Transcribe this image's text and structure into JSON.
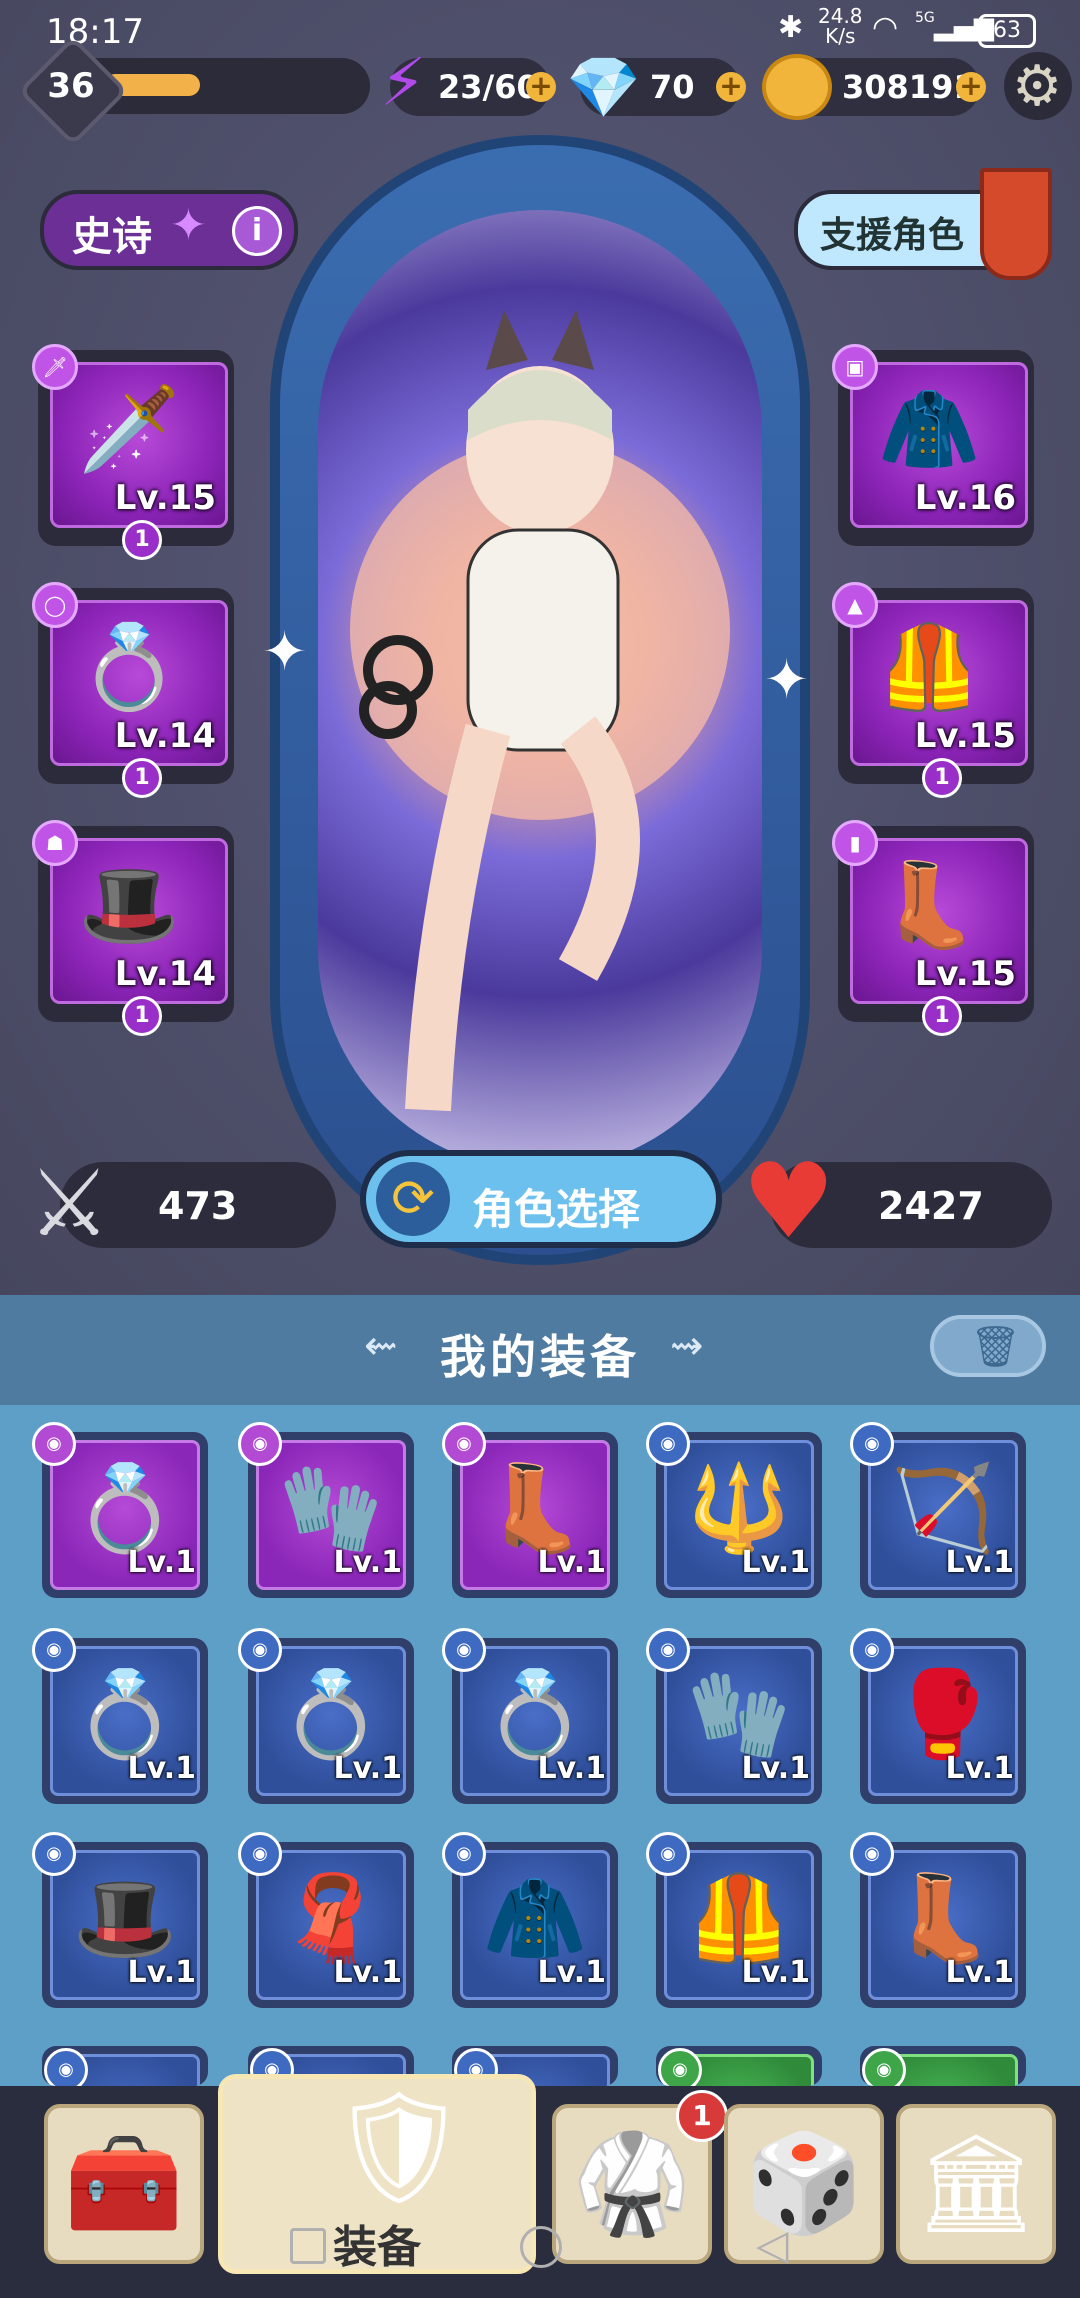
{
  "status_bar": {
    "time": "18:17",
    "net_speed_value": "24.8",
    "net_speed_unit": "K/s",
    "network": "5G",
    "battery": "63"
  },
  "player": {
    "level": "36",
    "xp_fraction": 0.3
  },
  "resources": {
    "energy": "23/60",
    "gems": "70",
    "coins": "308191"
  },
  "rarity_button": {
    "label": "史诗"
  },
  "support_button": {
    "label": "支援角色"
  },
  "left_slots": [
    {
      "name": "weapon-sword",
      "level": "Lv.15",
      "count": "1"
    },
    {
      "name": "ring",
      "level": "Lv.14",
      "count": "1"
    },
    {
      "name": "hat",
      "level": "Lv.14",
      "count": "1"
    }
  ],
  "right_slots": [
    {
      "name": "hood",
      "level": "Lv.16"
    },
    {
      "name": "armor",
      "level": "Lv.15",
      "count": "1"
    },
    {
      "name": "boots",
      "level": "Lv.15",
      "count": "1"
    }
  ],
  "stats": {
    "attack": "473",
    "hp": "2427"
  },
  "character_select": {
    "label": "角色选择"
  },
  "inventory": {
    "title": "我的装备",
    "items": [
      {
        "rarity": "purple",
        "icon": "ring-icon",
        "glyph": "💍",
        "level": "Lv.1"
      },
      {
        "rarity": "purple",
        "icon": "gauntlet-icon",
        "glyph": "🧤",
        "level": "Lv.1"
      },
      {
        "rarity": "purple",
        "icon": "boots-icon",
        "glyph": "👢",
        "level": "Lv.1"
      },
      {
        "rarity": "blue",
        "icon": "staff-icon",
        "glyph": "🔱",
        "level": "Lv.1"
      },
      {
        "rarity": "blue",
        "icon": "bow-icon",
        "glyph": "🏹",
        "level": "Lv.1"
      },
      {
        "rarity": "blue",
        "icon": "ring-icon",
        "glyph": "💍",
        "level": "Lv.1"
      },
      {
        "rarity": "blue",
        "icon": "ring-icon",
        "glyph": "💍",
        "level": "Lv.1"
      },
      {
        "rarity": "blue",
        "icon": "ring-icon",
        "glyph": "💍",
        "level": "Lv.1"
      },
      {
        "rarity": "blue",
        "icon": "gauntlet-icon",
        "glyph": "🧤",
        "level": "Lv.1"
      },
      {
        "rarity": "blue",
        "icon": "gauntlet-icon",
        "glyph": "🥊",
        "level": "Lv.1"
      },
      {
        "rarity": "blue",
        "icon": "hat-icon",
        "glyph": "🎩",
        "level": "Lv.1"
      },
      {
        "rarity": "blue",
        "icon": "scarf-icon",
        "glyph": "🧣",
        "level": "Lv.1"
      },
      {
        "rarity": "blue",
        "icon": "cloak-icon",
        "glyph": "🧥",
        "level": "Lv.1"
      },
      {
        "rarity": "blue",
        "icon": "armor-icon",
        "glyph": "🦺",
        "level": "Lv.1"
      },
      {
        "rarity": "blue",
        "icon": "boots-icon",
        "glyph": "👢",
        "level": "Lv.1"
      }
    ],
    "partial_row": [
      {
        "rarity": "blue"
      },
      {
        "rarity": "blue"
      },
      {
        "rarity": "blue"
      },
      {
        "rarity": "green"
      },
      {
        "rarity": "green"
      }
    ]
  },
  "nav": {
    "active_label": "装备",
    "shop_badge": "1",
    "items": [
      "treasure-chest",
      "equipment",
      "character",
      "map",
      "bank"
    ]
  },
  "colors": {
    "purple_rarity": "#8c24b8",
    "blue_rarity": "#2f4f9a",
    "green_rarity": "#2f8a3a",
    "coin": "#f1b53c"
  }
}
